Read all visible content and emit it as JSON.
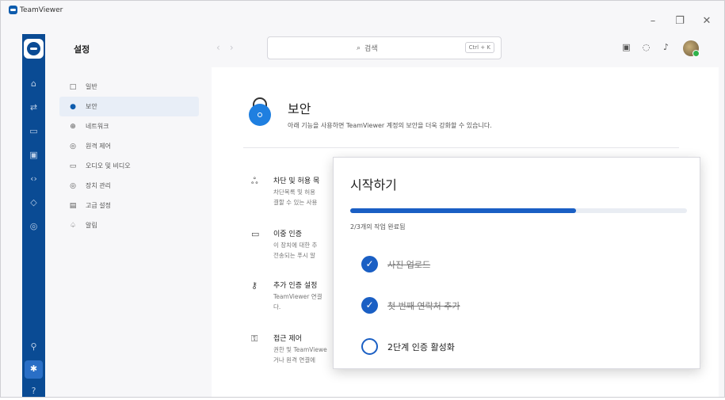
{
  "window": {
    "app_title": "TeamViewer",
    "controls": {
      "minimize": "–",
      "restore": "❐",
      "close": "✕"
    }
  },
  "rail": {
    "icons": [
      "home-icon",
      "transfer-icon",
      "remote-icon",
      "devices-icon",
      "code-icon",
      "diamond-icon",
      "target-icon",
      "share-icon",
      "settings-icon",
      "help-icon"
    ]
  },
  "header": {
    "title": "설정",
    "nav_back": "‹",
    "nav_forward": "›",
    "search": {
      "placeholder": "검색",
      "shortcut": "Ctrl + K"
    }
  },
  "settings_nav": {
    "items": [
      {
        "icon": "□",
        "label": "일반",
        "active": false
      },
      {
        "icon": "●",
        "label": "보안",
        "active": true
      },
      {
        "icon": "⊕",
        "label": "네트워크",
        "active": false
      },
      {
        "icon": "◎",
        "label": "원격 제어",
        "active": false
      },
      {
        "icon": "▭",
        "label": "오디오 및 비디오",
        "active": false
      },
      {
        "icon": "◎",
        "label": "장치 관리",
        "active": false
      },
      {
        "icon": "▤",
        "label": "고급 설정",
        "active": false
      },
      {
        "icon": "♤",
        "label": "알림",
        "active": false
      }
    ]
  },
  "security": {
    "title": "보안",
    "description": "아래 기능을 사용하면 TeamViewer 계정의 보안을 더욱 강화할 수 있습니다.",
    "features": [
      {
        "icon": "users-icon",
        "title": "차단 및 허용 목",
        "desc": [
          "차단목록 및 허용",
          "결할 수 있는 사용"
        ]
      },
      {
        "icon": "screen-icon",
        "title": "이중 인증",
        "desc": [
          "이 장치에 대한 추",
          "전송되는 푸시 알"
        ]
      },
      {
        "icon": "key-icon",
        "title": "추가 인증 설정",
        "desc": [
          "TeamViewer 연결",
          "다."
        ]
      },
      {
        "icon": "lock-icon",
        "title": "접근 제어",
        "desc": [
          "권한 및 TeamViewe",
          "거나 원격 연결에"
        ]
      }
    ]
  },
  "get_started": {
    "title": "시작하기",
    "progress_fraction": 0.67,
    "progress_text": "2/3개의 작업 완료됨",
    "tasks": [
      {
        "label": "사진 업로드",
        "done": true
      },
      {
        "label": "첫 번째 연락처 추가",
        "done": true
      },
      {
        "label": "2단계 인증 활성화",
        "done": false
      }
    ]
  },
  "colors": {
    "accent": "#1a5fc4",
    "rail": "#0a4b94",
    "security_icon": "#1f7fe0"
  }
}
